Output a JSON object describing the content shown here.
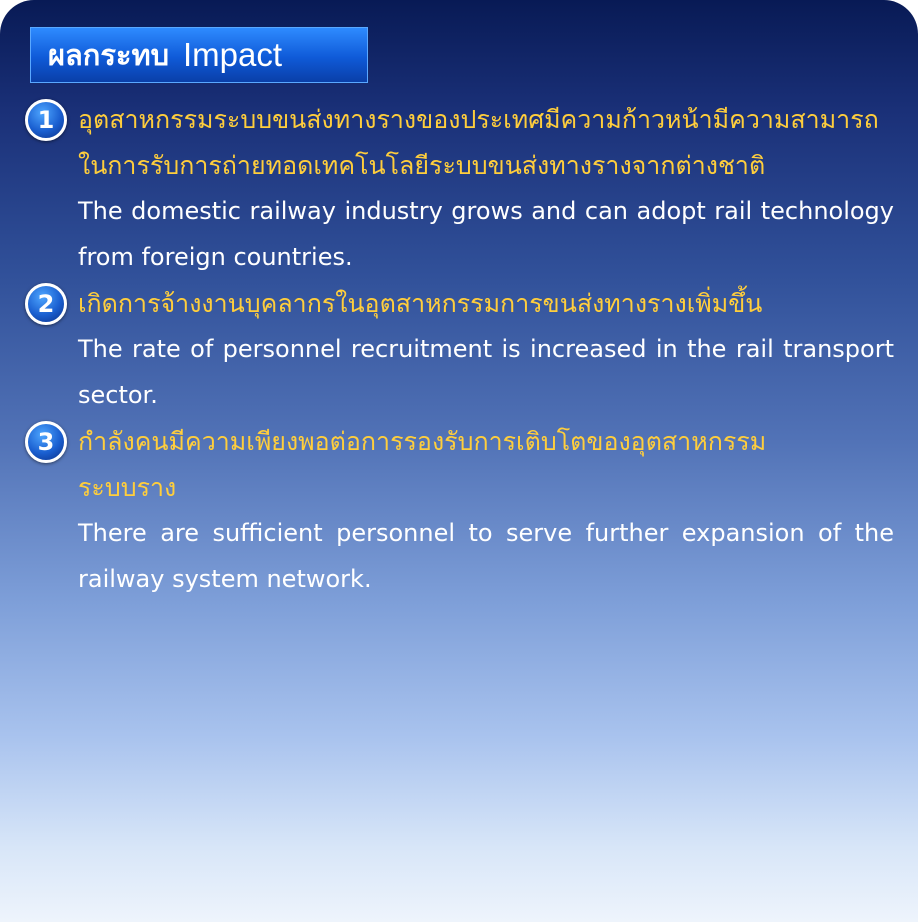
{
  "header": {
    "title_th": "ผลกระทบ",
    "title_en": "Impact"
  },
  "items": [
    {
      "number": "1",
      "th_lines": [
        "อุตสาหกรรมระบบขนส่งทางรางของประเทศมีความก้าวหน้ามีความสามารถ",
        "ในการรับการถ่ายทอดเทคโนโลยีระบบขนส่งทางรางจากต่างชาติ"
      ],
      "en": "The domestic railway industry grows and can adopt rail technology from foreign countries."
    },
    {
      "number": "2",
      "th_lines": [
        "เกิดการจ้างงานบุคลากรในอุตสาหกรรมการขนส่งทางรางเพิ่มขึ้น"
      ],
      "en": "The rate of personnel recruitment is increased in the rail transport sector."
    },
    {
      "number": "3",
      "th_lines": [
        "กำลังคนมีความเพียงพอต่อการรองรับการเติบโตของอุตสาหกรรม",
        "ระบบราง"
      ],
      "en": "There are sufficient personnel to serve further expansion of the railway system network."
    }
  ],
  "colors": {
    "thai_text": "#ffce3c",
    "english_text": "#ffffff",
    "title_bar": "#0f5ad8",
    "background_top": "#081a55",
    "background_bottom": "#eef4fc"
  }
}
